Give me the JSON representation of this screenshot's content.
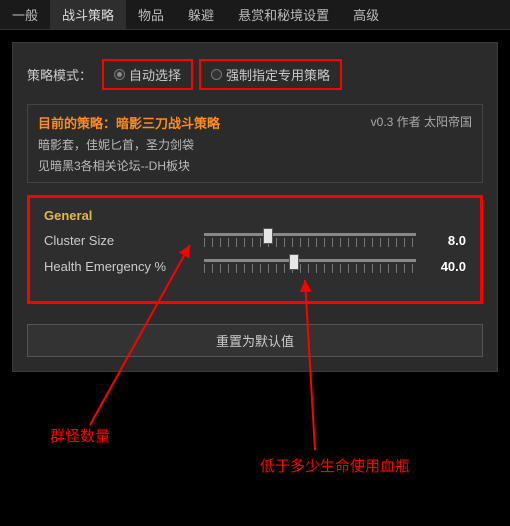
{
  "tabs": {
    "items": [
      "一般",
      "战斗策略",
      "物品",
      "躲避",
      "悬赏和秘境设置",
      "高级"
    ],
    "active_index": 1
  },
  "mode": {
    "label": "策略模式：",
    "opt_auto": "自动选择",
    "opt_forced": "强制指定专用策略",
    "selected": 0
  },
  "info": {
    "title": "目前的策略：暗影三刀战斗策略",
    "line1": "暗影套，佳妮匕首，圣力剑袋",
    "line2": "见暗黑3各相关论坛--DH板块",
    "version": "v0.3 作者 太阳帝国"
  },
  "general": {
    "title": "General",
    "cluster_label": "Cluster Size",
    "cluster_value": "8.0",
    "cluster_pct": 28,
    "health_label": "Health Emergency %",
    "health_value": "40.0",
    "health_pct": 40
  },
  "reset_label": "重置为默认值",
  "annotations": {
    "cluster": "群怪数量",
    "health": "低于多少生命使用血瓶"
  }
}
